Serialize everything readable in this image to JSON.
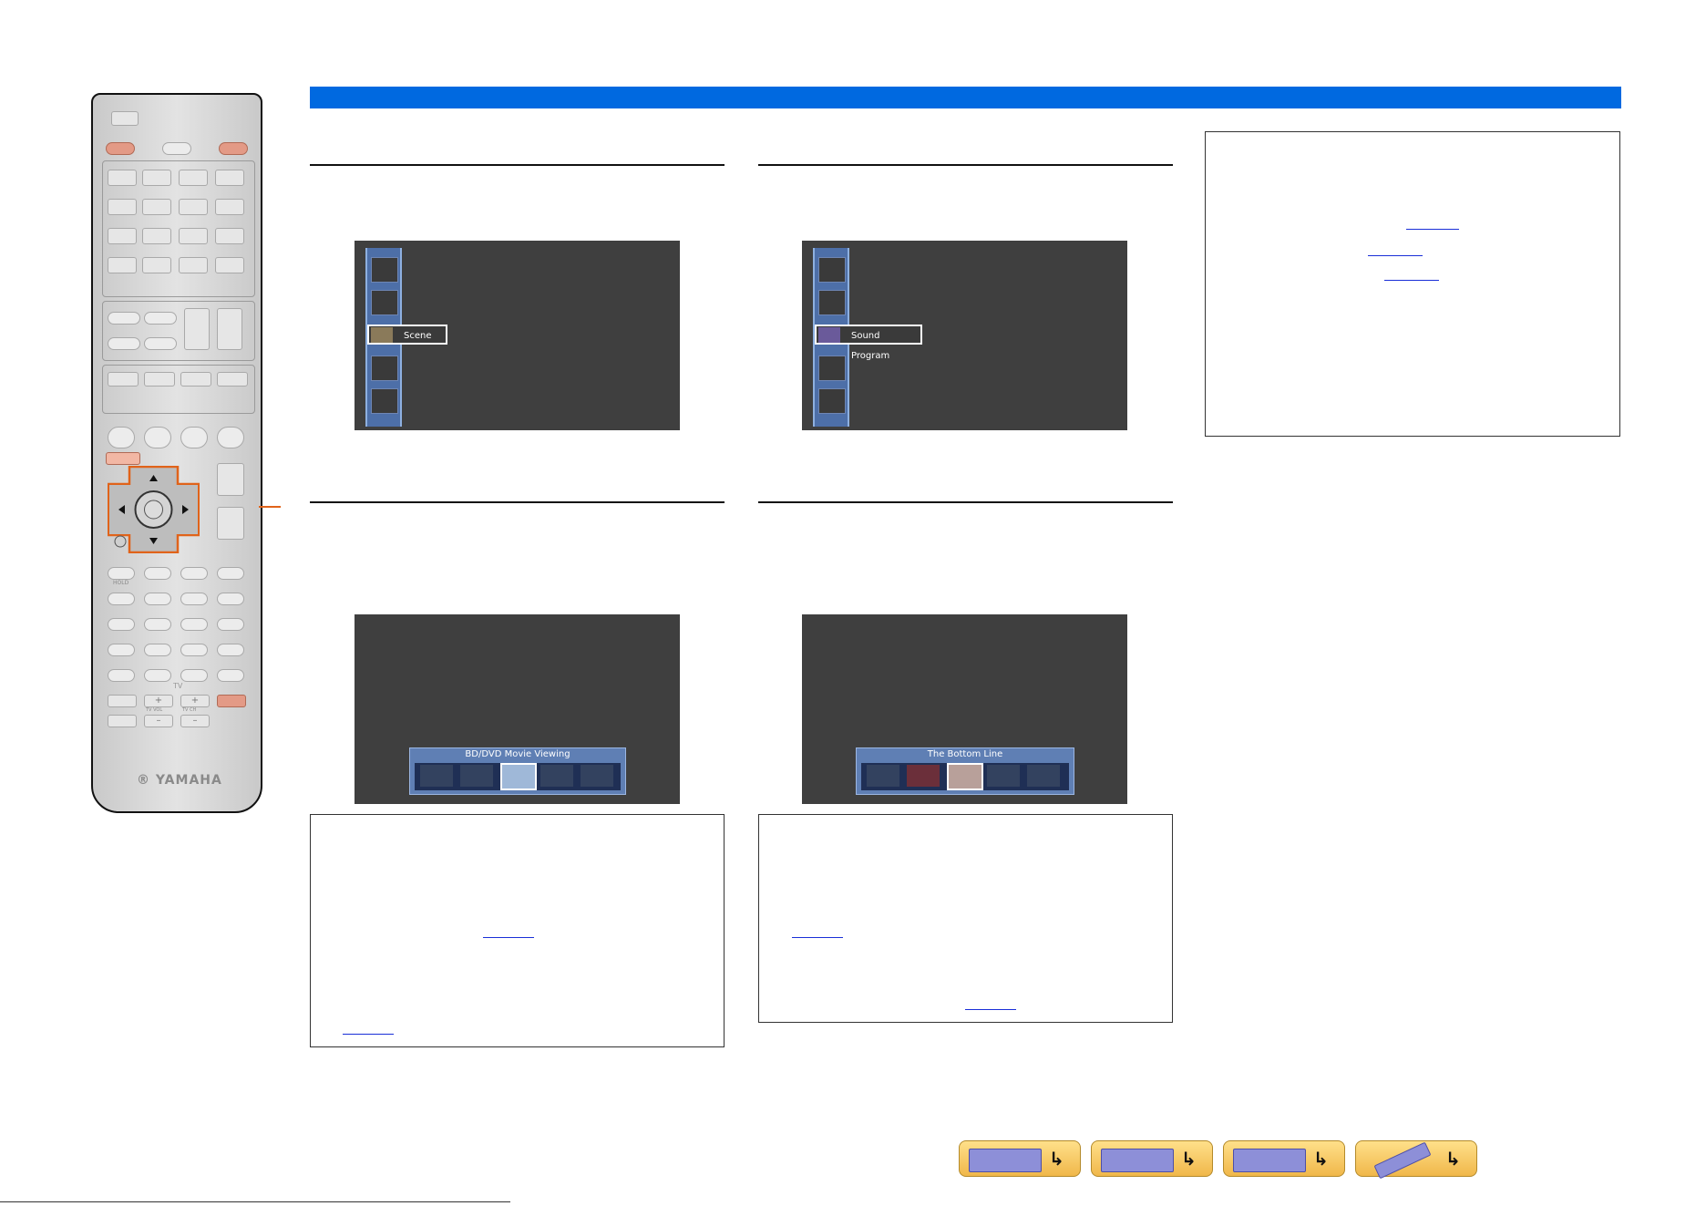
{
  "remote": {
    "brand": "® YAMAHA",
    "tv_label": "TV",
    "tv_vol": "TV VOL",
    "tv_ch": "TV CH",
    "hold": "HOLD",
    "plus": "+",
    "minus": "–"
  },
  "panels": [
    {
      "id": "scene",
      "selected_label": "Scene"
    },
    {
      "id": "sound-program",
      "selected_label": "Sound Program"
    },
    {
      "id": "scene-select",
      "strip_title": "BD/DVD Movie Viewing"
    },
    {
      "id": "program-select",
      "strip_title": "The Bottom Line"
    }
  ],
  "colors": {
    "header_bar": "#0069e0",
    "remote_highlight": "#e0631a",
    "link": "#1a2fd8"
  },
  "nav_buttons": [
    {
      "name": "front-panel",
      "icon": "receiver-front-icon"
    },
    {
      "name": "rear-panel",
      "icon": "receiver-rear-icon"
    },
    {
      "name": "display",
      "icon": "display-icon"
    },
    {
      "name": "remote",
      "icon": "remote-icon"
    }
  ]
}
